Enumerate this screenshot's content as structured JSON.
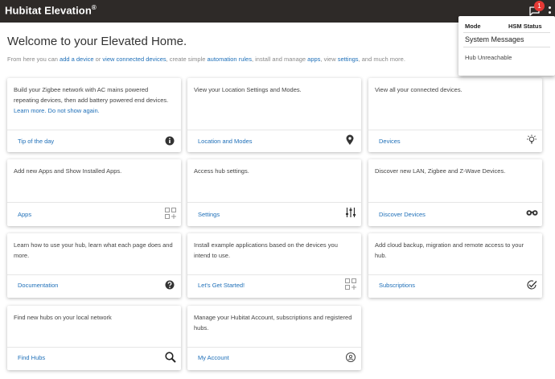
{
  "app": {
    "brand": "Hubitat Elevation",
    "brand_mark": "®"
  },
  "topbar": {
    "notification_count": "1"
  },
  "dropdown": {
    "col_mode": "Mode",
    "col_hsm": "HSM Status",
    "section_title": "System Messages",
    "message": "Hub Unreachable"
  },
  "welcome": {
    "title": "Welcome to your Elevated Home.",
    "intro": {
      "t1": "From here you can ",
      "l1": "add a device",
      "t2": " or ",
      "l2": "view connected devices",
      "t3": ", create simple ",
      "l3": "automation rules",
      "t4": ", install and manage ",
      "l4": "apps",
      "t5": ", view ",
      "l5": "settings",
      "t6": ", and much more."
    }
  },
  "cards": {
    "tip": {
      "desc": "Build your Zigbee network with AC mains powered repeating devices, then add battery powered end devices.",
      "learn_more": "Learn more.",
      "dont_show": "Do not show again.",
      "link": "Tip of the day",
      "icon": "info-icon"
    },
    "location": {
      "desc": "View your Location Settings and Modes.",
      "link": "Location and Modes",
      "icon": "map-pin-icon"
    },
    "devices": {
      "desc": "View all your connected devices.",
      "link": "Devices",
      "icon": "lightbulb-icon"
    },
    "apps": {
      "desc": "Add new Apps and Show Installed Apps.",
      "link": "Apps",
      "icon": "apps-grid-icon"
    },
    "settings": {
      "desc": "Access hub settings.",
      "link": "Settings",
      "icon": "sliders-icon"
    },
    "discover": {
      "desc": "Discover new LAN, Zigbee and Z-Wave Devices.",
      "link": "Discover Devices",
      "icon": "binoculars-icon"
    },
    "documentation": {
      "desc": "Learn how to use your hub, learn what each page does and more.",
      "link": "Documentation",
      "icon": "help-circle-icon"
    },
    "started": {
      "desc": "Install example applications based on the devices you intend to use.",
      "link": "Let's Get Started!",
      "icon": "apps-grid-icon"
    },
    "subscriptions": {
      "desc": "Add cloud backup, migration and remote access to your hub.",
      "link": "Subscriptions",
      "icon": "check-circle-icon"
    },
    "findhubs": {
      "desc": "Find new hubs on your local network",
      "link": "Find Hubs",
      "icon": "search-icon"
    },
    "account": {
      "desc": "Manage your Hubitat Account, subscriptions and registered hubs.",
      "link": "My Account",
      "icon": "account-icon"
    }
  },
  "colors": {
    "topbar": "#2e2a28",
    "link": "#1e6fb8",
    "badge": "#e53935"
  }
}
